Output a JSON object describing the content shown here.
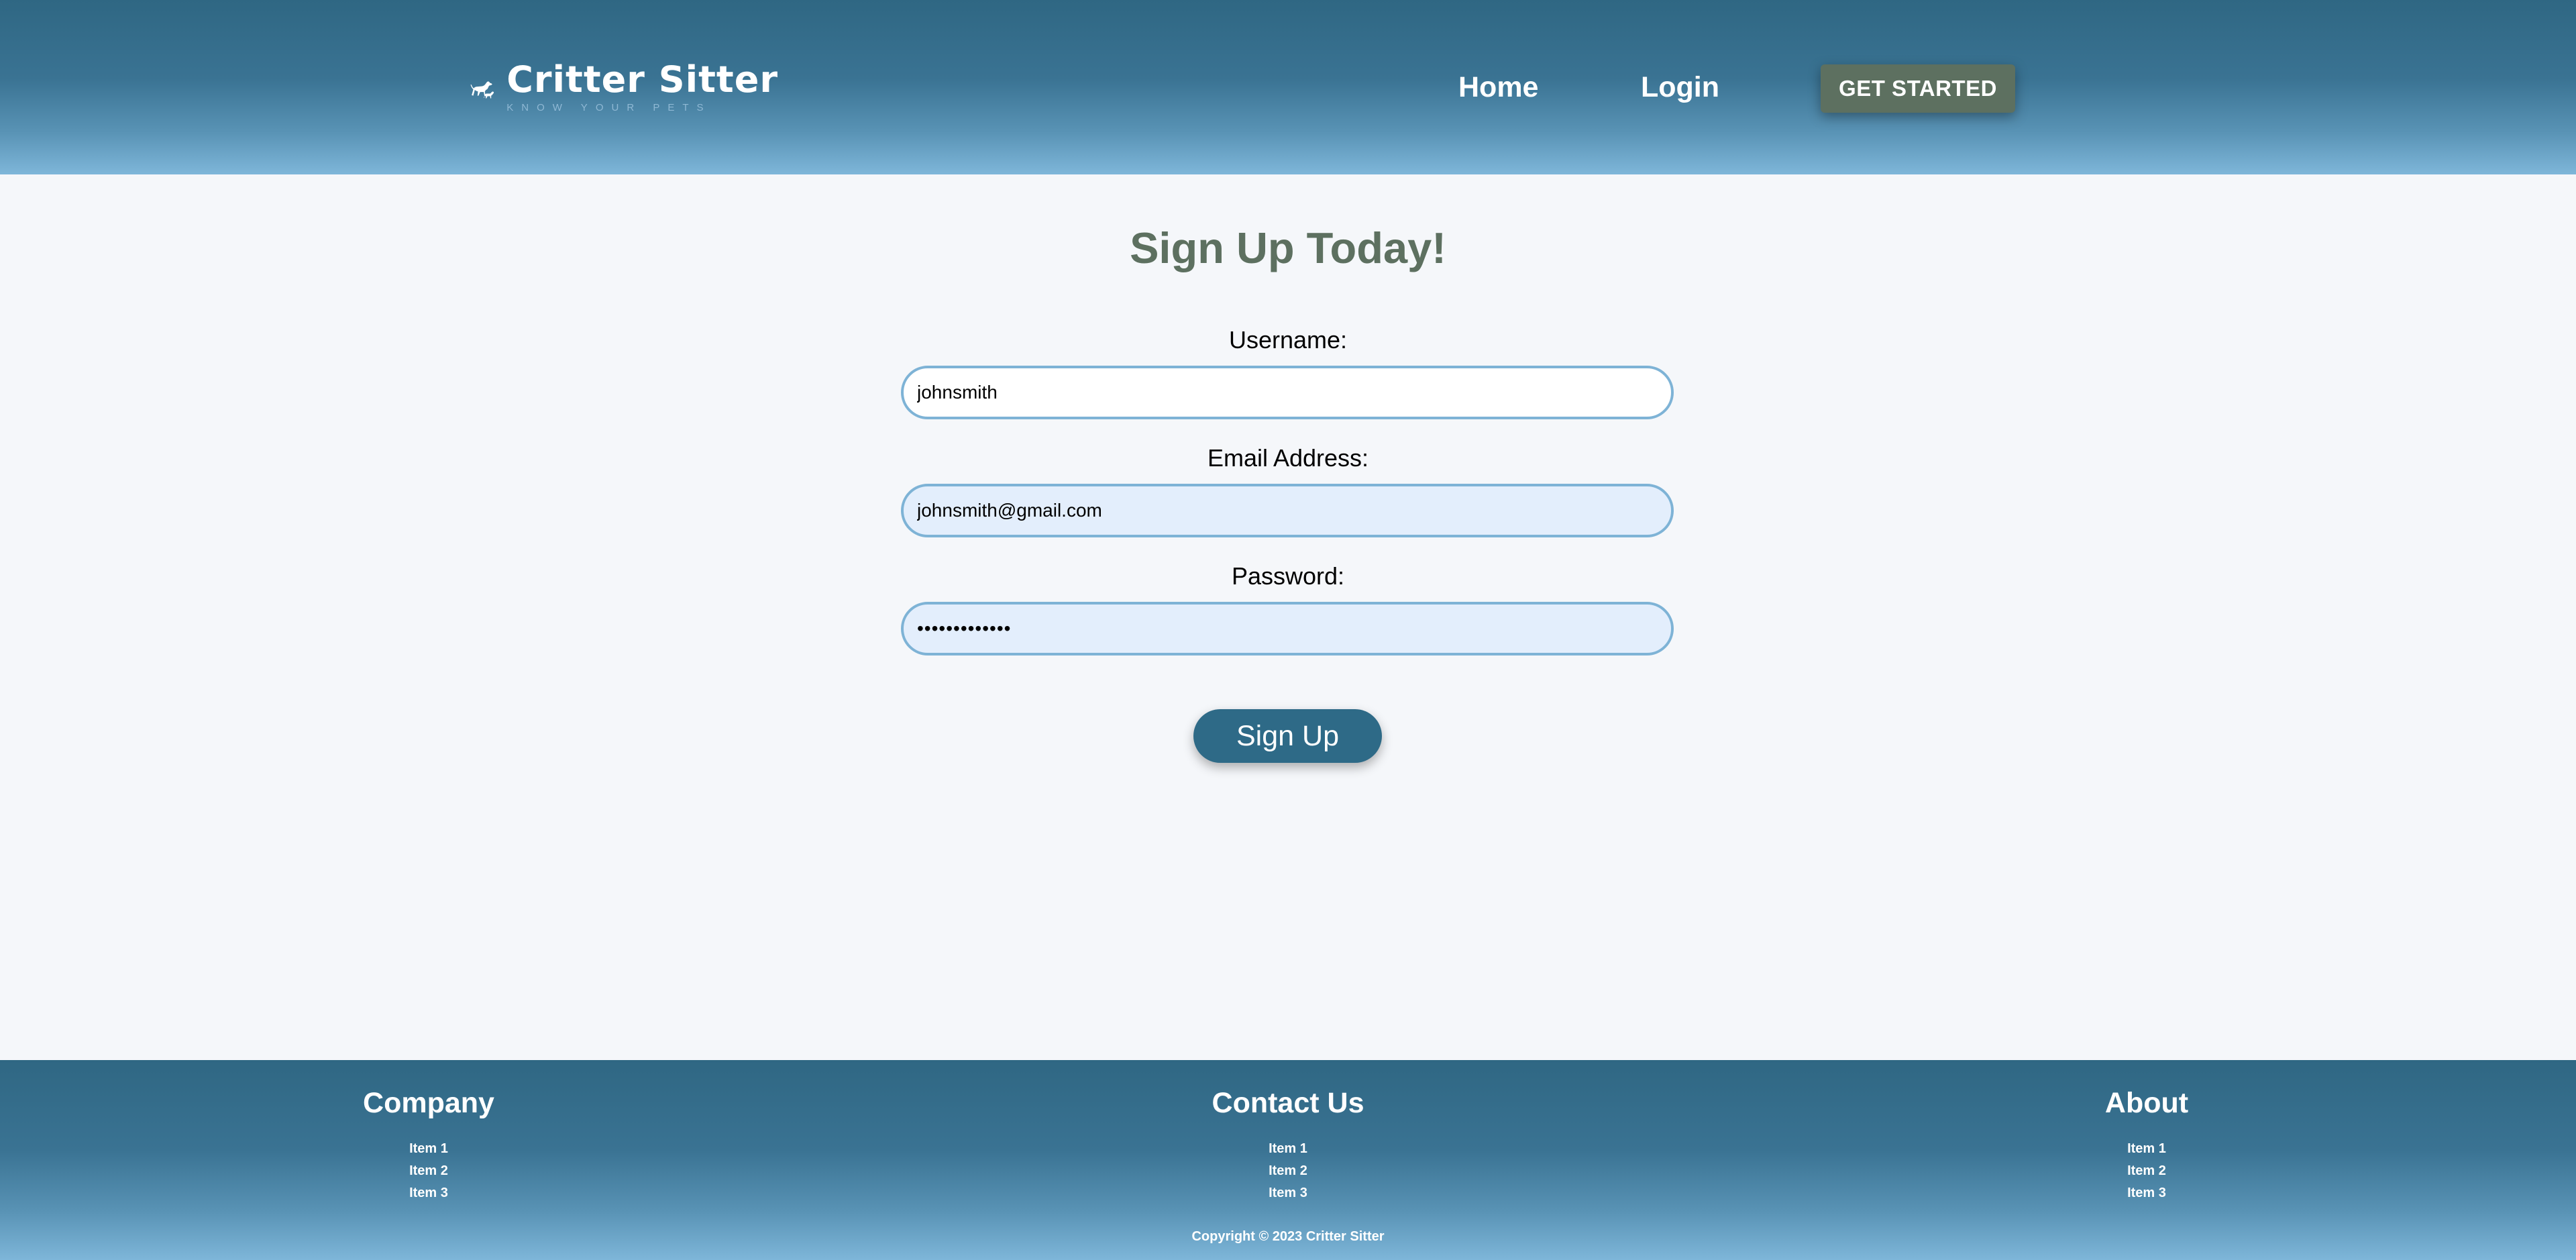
{
  "header": {
    "logo_title": "Critter Sitter",
    "logo_tagline": "KNOW YOUR PETS",
    "nav": [
      {
        "label": "Home"
      },
      {
        "label": "Login"
      }
    ],
    "cta_label": "GET STARTED"
  },
  "form": {
    "title": "Sign Up Today!",
    "username_label": "Username:",
    "username_value": "johnsmith",
    "email_label": "Email Address:",
    "email_value": "johnsmith@gmail.com",
    "password_label": "Password:",
    "password_value": "•••••••••••••",
    "submit_label": "Sign Up"
  },
  "footer": {
    "columns": [
      {
        "heading": "Company",
        "items": [
          "Item 1",
          "Item 2",
          "Item 3"
        ]
      },
      {
        "heading": "Contact Us",
        "items": [
          "Item 1",
          "Item 2",
          "Item 3"
        ]
      },
      {
        "heading": "About",
        "items": [
          "Item 1",
          "Item 2",
          "Item 3"
        ]
      }
    ],
    "copyright": "Copyright © 2023 Critter Sitter"
  },
  "colors": {
    "header_dark": "#2f6783",
    "header_light": "#7eb6d9",
    "accent_green": "#5d7060",
    "button_blue": "#2e6a87",
    "input_border": "#7eb3d6",
    "input_fill_autofill": "#e3eefc",
    "page_background": "#f5f7fa"
  },
  "icons": {
    "logo": "dog-and-cat-silhouette-icon"
  }
}
